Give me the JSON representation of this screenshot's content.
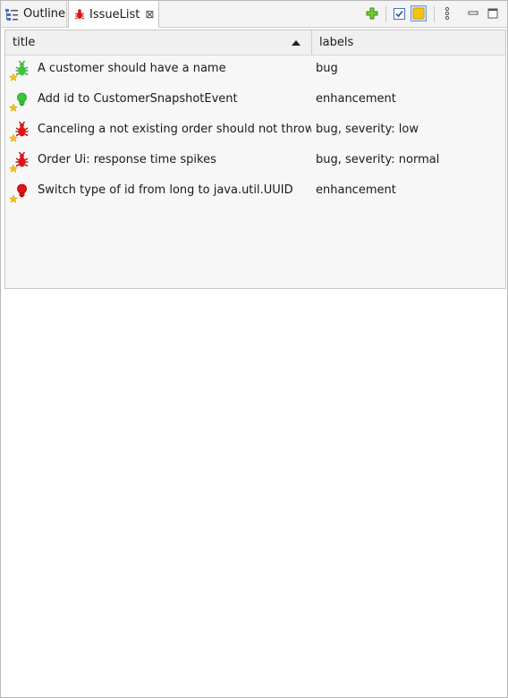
{
  "tabs": {
    "outline": {
      "label": "Outline",
      "icon": "outline-icon"
    },
    "issues": {
      "label": "IssueList",
      "icon": "bug-icon"
    }
  },
  "toolbar": [
    "add-icon",
    "checkbox-icon",
    "star-toggle-icon",
    "view-menu-icon",
    "minimize-icon",
    "maximize-icon"
  ],
  "table": {
    "columns": [
      "title",
      "labels"
    ],
    "sort_column": "title",
    "rows": [
      {
        "title": "A customer should have a name",
        "labels": "bug",
        "icon": "green-bug-icon",
        "starred": true
      },
      {
        "title": "Add id to CustomerSnapshotEvent",
        "labels": "enhancement",
        "icon": "green-bulb-icon",
        "starred": true
      },
      {
        "title": "Canceling a not existing order should not throw Ex",
        "labels": "bug, severity: low",
        "icon": "red-bug-icon",
        "starred": true
      },
      {
        "title": "Order Ui: response time spikes",
        "labels": "bug, severity: normal",
        "icon": "red-bug-icon",
        "starred": true
      },
      {
        "title": "Switch type of id from long to java.util.UUID",
        "labels": "enhancement",
        "icon": "red-bulb-icon",
        "starred": true
      }
    ]
  },
  "colors": {
    "green": "#3cc43c",
    "red": "#e11414",
    "star": "#f5c211",
    "accent": "#3b6fd8"
  }
}
